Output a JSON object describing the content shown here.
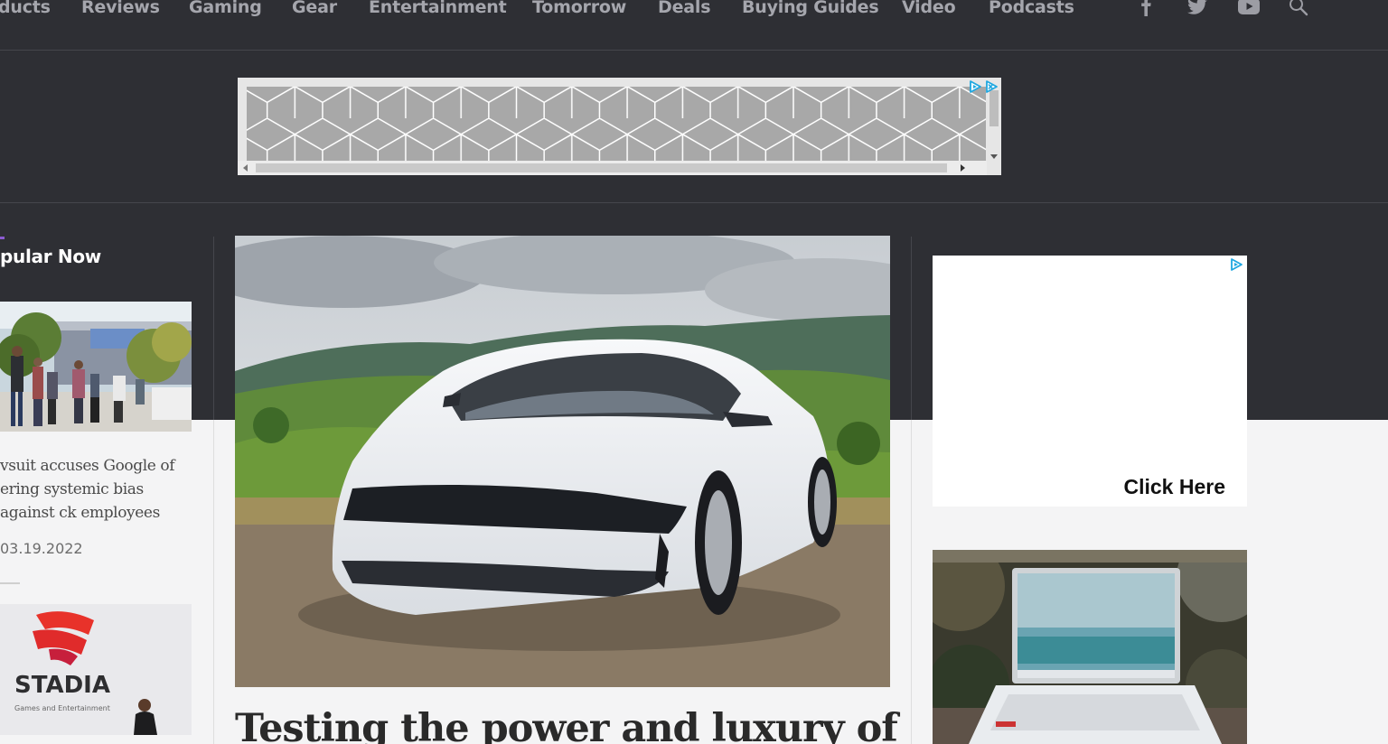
{
  "nav": {
    "items": [
      {
        "label": "ducts"
      },
      {
        "label": "Reviews"
      },
      {
        "label": "Gaming"
      },
      {
        "label": "Gear"
      },
      {
        "label": "Entertainment"
      },
      {
        "label": "Tomorrow"
      },
      {
        "label": "Deals"
      },
      {
        "label": "Buying Guides"
      },
      {
        "label": "Video"
      },
      {
        "label": "Podcasts"
      }
    ],
    "icons": [
      "facebook-icon",
      "twitter-icon",
      "youtube-icon",
      "search-icon"
    ]
  },
  "sidebar": {
    "title": "pular Now",
    "stories": [
      {
        "headline": "vsuit accuses Google of ering systemic bias against ck employees",
        "date": "03.19.2022"
      },
      {
        "image_text": {
          "brand": "STADIA",
          "tagline": "Games and Entertainment"
        }
      }
    ]
  },
  "main": {
    "headline": "Testing the power and luxury of"
  },
  "right_ad": {
    "cta": "Click Here"
  },
  "colors": {
    "dark_bg": "#2e2f34",
    "nav_text": "#a5a6ad",
    "accent": "#8c5bd1",
    "page_bg": "#f4f4f5",
    "adchoices_blue": "#1fa7e0"
  }
}
